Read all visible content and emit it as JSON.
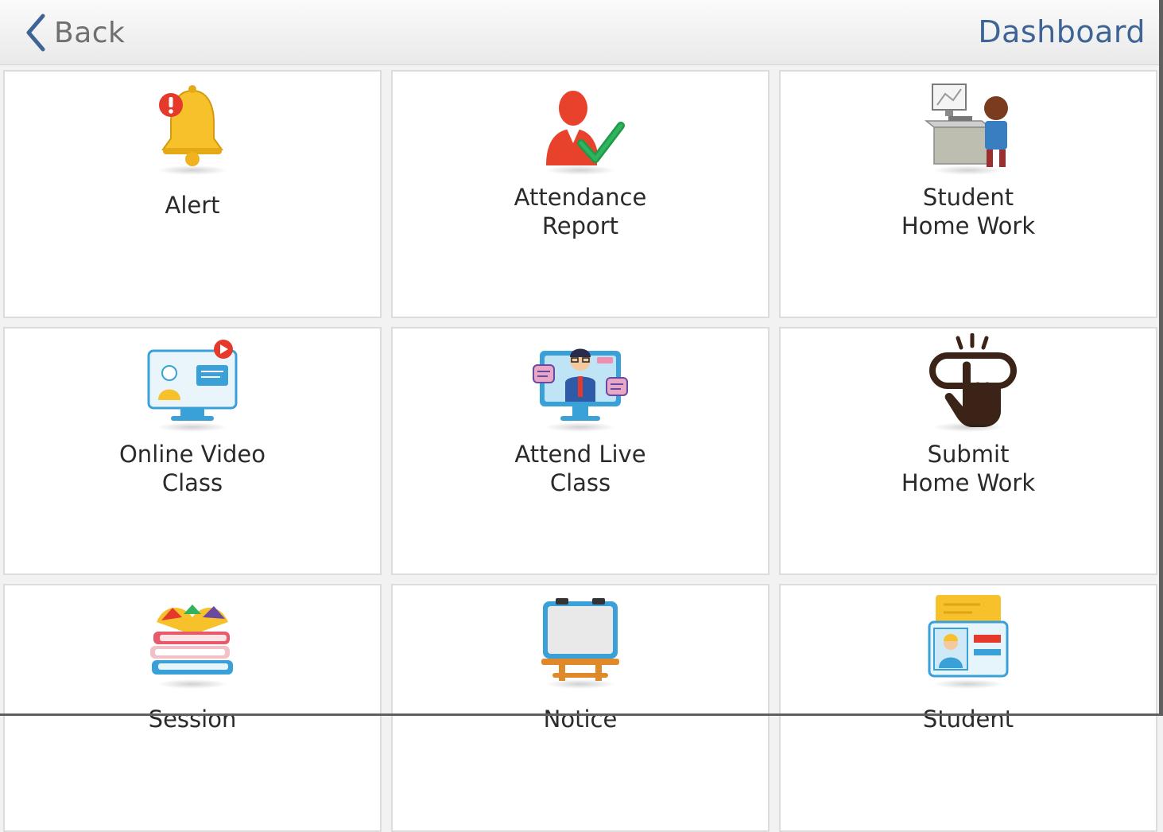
{
  "header": {
    "back_label": "Back",
    "title": "Dashboard",
    "back_icon": "chevron-left-icon",
    "title_color": "#3e6495"
  },
  "tiles": [
    {
      "label": "Alert",
      "icon": "bell-alert-icon"
    },
    {
      "label": "Attendance\nReport",
      "icon": "attendance-check-icon"
    },
    {
      "label": "Student\nHome Work",
      "icon": "student-desk-icon"
    },
    {
      "label": "Online Video\nClass",
      "icon": "video-presentation-icon"
    },
    {
      "label": "Attend Live\nClass",
      "icon": "live-teacher-icon"
    },
    {
      "label": "Submit\nHome Work",
      "icon": "tap-button-icon"
    },
    {
      "label": "Session",
      "icon": "books-stack-icon"
    },
    {
      "label": "Notice",
      "icon": "notice-board-icon"
    },
    {
      "label": "Student",
      "icon": "student-id-card-icon"
    }
  ]
}
